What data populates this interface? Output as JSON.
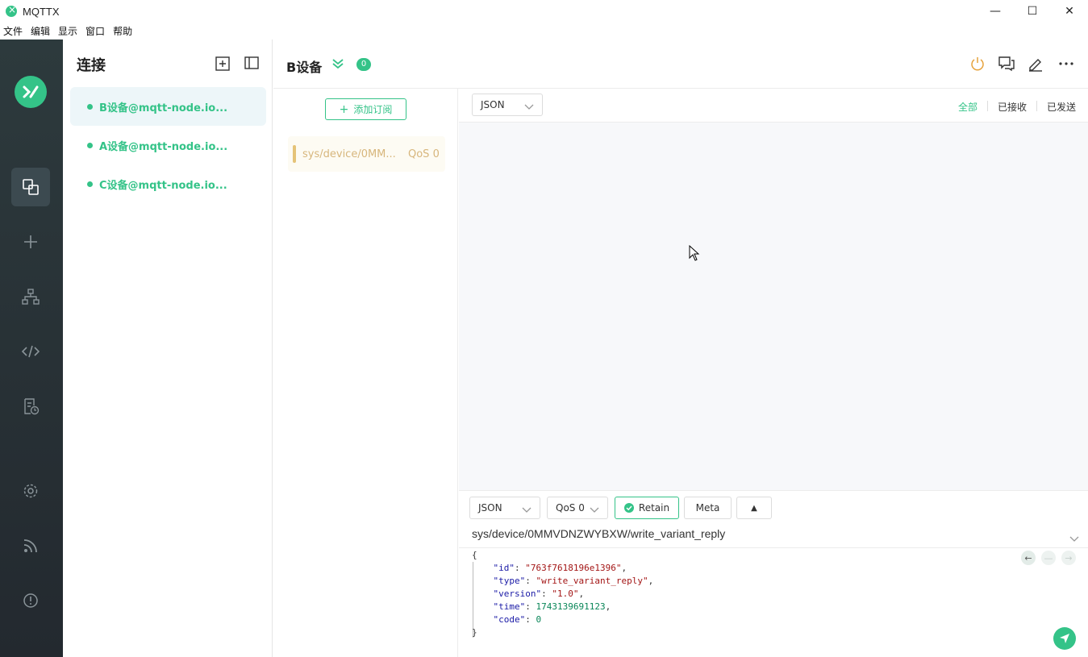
{
  "app": {
    "title": "MQTTX"
  },
  "window_controls": {
    "minimize": "—",
    "maximize": "☐",
    "close": "✕"
  },
  "menu": [
    "文件",
    "编辑",
    "显示",
    "窗口",
    "帮助"
  ],
  "sidebar_nav": [
    "connections-icon",
    "plus-icon",
    "topology-icon",
    "code-icon",
    "log-icon",
    "settings-icon",
    "feed-icon",
    "info-icon"
  ],
  "connections": {
    "title": "连接",
    "items": [
      {
        "label": "B设备@mqtt-node.io...",
        "active": true
      },
      {
        "label": "A设备@mqtt-node.io...",
        "active": false
      },
      {
        "label": "C设备@mqtt-node.io...",
        "active": false
      }
    ]
  },
  "header": {
    "name": "B设备",
    "count": "0"
  },
  "subscriptions": {
    "add_label": "添加订阅",
    "items": [
      {
        "topic": "sys/device/0MM...",
        "qos": "QoS 0"
      }
    ]
  },
  "message_toolbar": {
    "format": "JSON",
    "tabs": [
      "全部",
      "已接收",
      "已发送"
    ],
    "active_tab": "全部"
  },
  "compose": {
    "format": "JSON",
    "qos": "QoS 0",
    "retain_label": "Retain",
    "meta_label": "Meta",
    "expand_label": "▲",
    "topic": "sys/device/0MMVDNZWYBXW/write_variant_reply",
    "payload": {
      "open": "{",
      "id_key": "\"id\"",
      "id_val": "\"763f7618196e1396\"",
      "type_key": "\"type\"",
      "type_val": "\"write_variant_reply\"",
      "version_key": "\"version\"",
      "version_val": "\"1.0\"",
      "time_key": "\"time\"",
      "time_val": "1743139691123",
      "code_key": "\"code\"",
      "code_val": "0",
      "close": "}"
    }
  },
  "colors": {
    "accent": "#34c388",
    "sidebar_bg": "#2d3a3d",
    "topic_color": "#d7b67c"
  }
}
